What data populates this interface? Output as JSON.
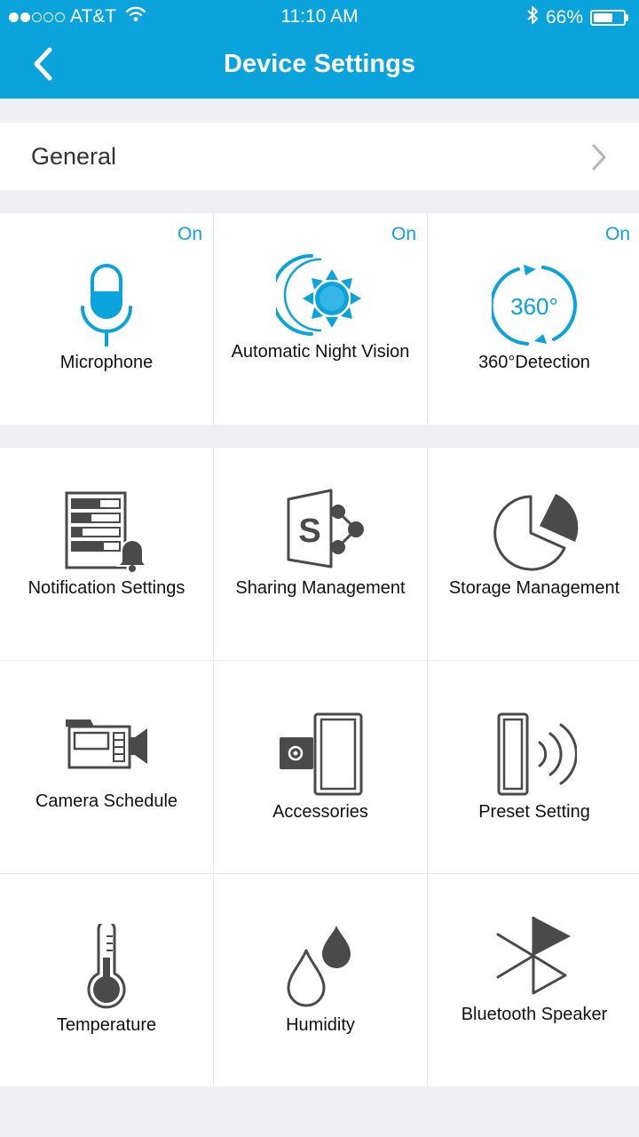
{
  "status_bar": {
    "carrier": "AT&T",
    "time": "11:10 AM",
    "battery_pct": "66%",
    "battery_level": 0.66,
    "signal_bars": [
      1,
      1,
      0,
      0,
      0
    ]
  },
  "header": {
    "title": "Device Settings",
    "back_icon": "chevron-left-icon"
  },
  "general": {
    "label": "General",
    "chevron_icon": "chevron-right-icon"
  },
  "features": [
    {
      "label": "Microphone",
      "status": "On",
      "icon": "microphone-icon"
    },
    {
      "label": "Automatic Night Vision",
      "status": "On",
      "icon": "night-vision-icon"
    },
    {
      "label": "360°Detection",
      "status": "On",
      "icon": "360-detection-icon"
    }
  ],
  "settings": [
    {
      "label": "Notification Settings",
      "icon": "notification-settings-icon"
    },
    {
      "label": "Sharing Management",
      "icon": "sharing-icon"
    },
    {
      "label": "Storage Management",
      "icon": "storage-pie-icon"
    },
    {
      "label": "Camera Schedule",
      "icon": "camera-schedule-icon"
    },
    {
      "label": "Accessories",
      "icon": "accessories-icon"
    },
    {
      "label": "Preset Setting",
      "icon": "preset-icon"
    },
    {
      "label": "Temperature",
      "icon": "thermometer-icon"
    },
    {
      "label": "Humidity",
      "icon": "humidity-icon"
    },
    {
      "label": "Bluetooth Speaker",
      "icon": "bluetooth-speaker-icon"
    }
  ],
  "colors": {
    "accent": "#0aa3dc",
    "background": "#efeff4",
    "icon_dark": "#4a4a4a"
  }
}
